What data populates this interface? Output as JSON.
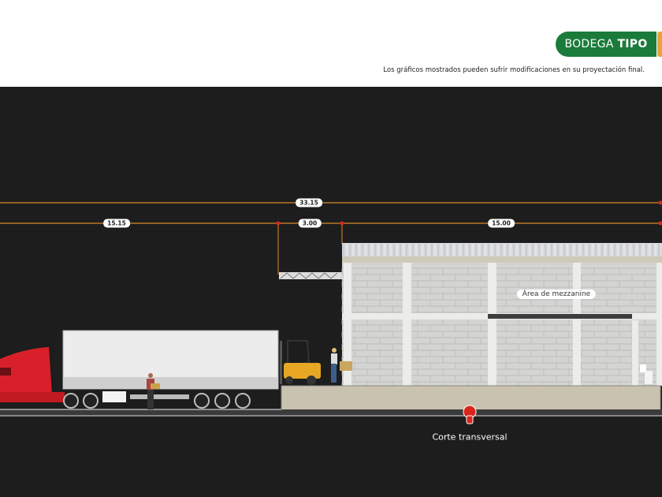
{
  "header": {
    "badge": {
      "prefix": "BODEGA",
      "bold": "TIPO"
    },
    "note": "Los gráficos mostrados pueden sufrir modificaciones en su proyectación final."
  },
  "dimensions": {
    "total": "33.15",
    "segments": [
      "15.15",
      "3.00",
      "15.00"
    ]
  },
  "labels": {
    "mezzanine": "Área de mezzanine",
    "section": "Corte transversal"
  },
  "colors": {
    "brand_green": "#1b7b3b",
    "dimension_line": "#d88a2a",
    "marker_red": "#d9261c",
    "background": "#1d1d1d"
  }
}
